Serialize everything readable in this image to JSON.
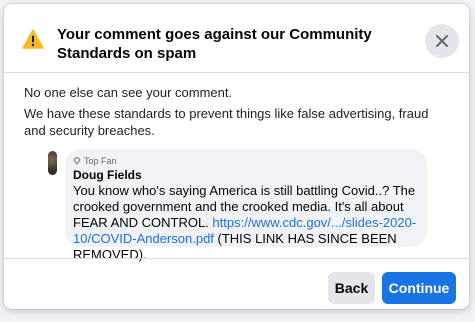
{
  "dialog": {
    "title": "Your comment goes against our Community Standards on spam",
    "close_icon": "close-icon",
    "warning_icon": "warning-triangle-icon",
    "warning_color": "#f7b928"
  },
  "body": {
    "paragraph1": "No one else can see your comment.",
    "paragraph2": "We have these standards to prevent things like false advertising, fraud and security breaches."
  },
  "comment": {
    "badge": "Top Fan",
    "author": "Doug Fields",
    "text_before_link": "You know who's saying America is still battling Covid..? The crooked government and the crooked media. It's all about FEAR AND CONTROL. ",
    "link_text": "https://www.cdc.gov/.../slides-2020-10/COVID-Anderson.pdf",
    "text_after_link": " (THIS LINK HAS SINCE BEEN REMOVED)."
  },
  "footer": {
    "back_label": "Back",
    "continue_label": "Continue",
    "continue_color": "#1b74e4"
  }
}
